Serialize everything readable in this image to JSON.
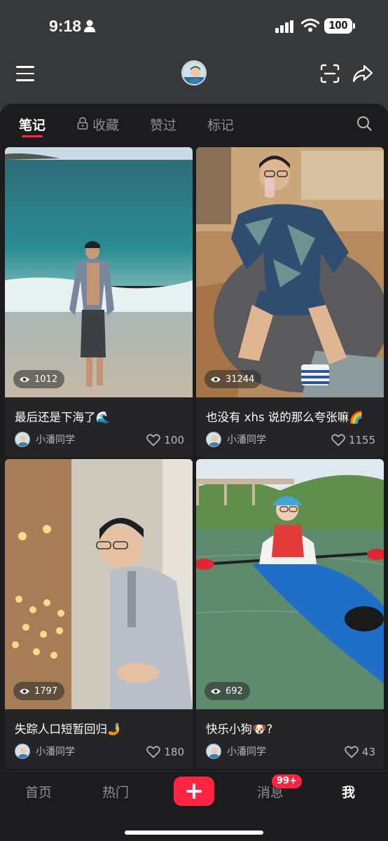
{
  "status_bar": {
    "time": "9:18",
    "battery": "100"
  },
  "tabs": [
    {
      "label": "笔记",
      "active": true
    },
    {
      "label": "收藏",
      "active": false
    },
    {
      "label": "赞过",
      "active": false
    },
    {
      "label": "标记",
      "active": false
    }
  ],
  "notes": [
    {
      "title": "最后还是下海了🌊",
      "views": "1012",
      "author": "小潘同学",
      "likes": "100"
    },
    {
      "title": "也没有 xhs 说的那么夸张嘛🌈",
      "views": "31244",
      "author": "小潘同学",
      "likes": "1155"
    },
    {
      "title": "失踪人口短暂回归🤳",
      "views": "1797",
      "author": "小潘同学",
      "likes": "180"
    },
    {
      "title": "快乐小狗🐶?",
      "views": "692",
      "author": "小潘同学",
      "likes": "43"
    }
  ],
  "bottom_nav": {
    "home": "首页",
    "hot": "热门",
    "messages": "消息",
    "messages_badge": "99+",
    "me": "我"
  },
  "colors": {
    "accent": "#ff2442",
    "sheet_background": "#1c1c1e",
    "header_background": "#36383a"
  },
  "icons": [
    "menu-icon",
    "scan-icon",
    "share-icon",
    "lock-icon",
    "search-icon",
    "eye-icon",
    "heart-icon",
    "plus-icon"
  ]
}
